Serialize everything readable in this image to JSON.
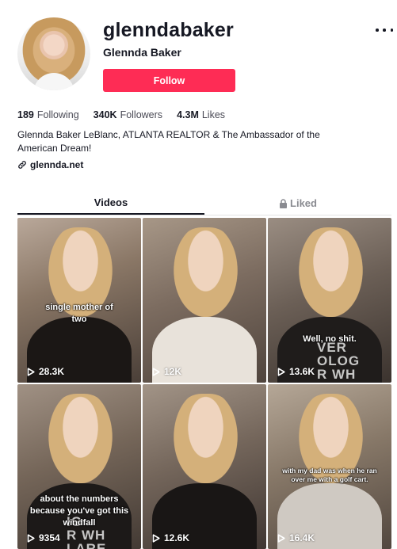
{
  "profile": {
    "username": "glenndabaker",
    "nickname": "Glennda Baker",
    "follow_label": "Follow",
    "bio": "Glennda Baker LeBlanc, ATLANTA REALTOR & The Ambassador of the American Dream!",
    "link": "glennda.net"
  },
  "stats": {
    "following_count": "189",
    "following_label": "Following",
    "followers_count": "340K",
    "followers_label": "Followers",
    "likes_count": "4.3M",
    "likes_label": "Likes"
  },
  "tabs": {
    "videos": "Videos",
    "liked": "Liked"
  },
  "icons": {
    "more": "more-dots-icon",
    "link": "link-icon",
    "lock": "lock-icon",
    "play": "play-icon"
  },
  "colors": {
    "accent": "#fe2c55",
    "text": "#161823",
    "muted": "#8a8b91"
  },
  "videos": [
    {
      "views": "28.3K",
      "caption": "single mother of two"
    },
    {
      "views": "12K",
      "caption": ""
    },
    {
      "views": "13.6K",
      "caption": "Well, no shit."
    },
    {
      "views": "9354",
      "caption": "about the numbers because you've got this windfall"
    },
    {
      "views": "12.6K",
      "caption": ""
    },
    {
      "views": "16.4K",
      "caption": "with my dad was when he ran over me with a golf cart."
    }
  ]
}
